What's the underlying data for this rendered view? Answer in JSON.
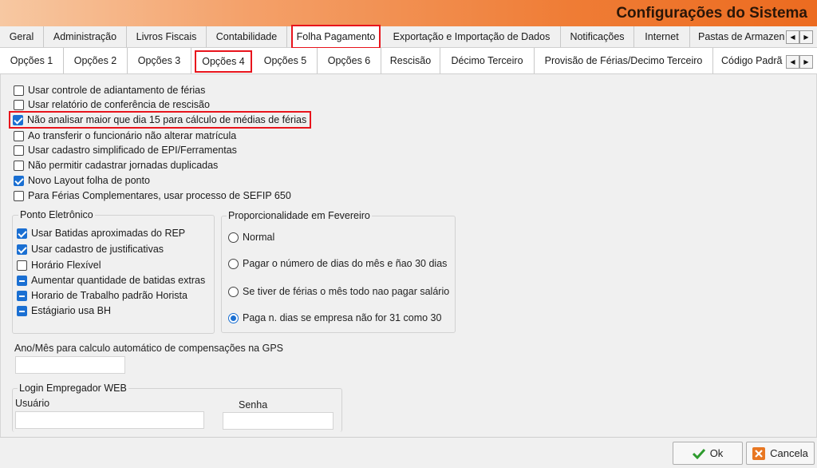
{
  "window": {
    "title": "Configurações do Sistema"
  },
  "tabs_main": {
    "items": [
      "Geral",
      "Administração",
      "Livros Fiscais",
      "Contabilidade",
      "Folha Pagamento",
      "Exportação e Importação de Dados",
      "Notificações",
      "Internet",
      "Pastas de Armazen"
    ],
    "active": "Folha Pagamento"
  },
  "tabs_sub": {
    "items": [
      "Opções 1",
      "Opções 2",
      "Opções 3",
      "Opções 4",
      "Opções 5",
      "Opções 6",
      "Rescisão",
      "Décimo Terceiro",
      "Provisão de Férias/Decimo Terceiro",
      "Código Padrã"
    ],
    "active": "Opções 4"
  },
  "options": [
    {
      "label": "Usar controle de adiantamento de férias",
      "checked": false
    },
    {
      "label": "Usar relatório de conferência de rescisão",
      "checked": false
    },
    {
      "label": "Não analisar maior que dia 15 para cálculo de médias de férias",
      "checked": true
    },
    {
      "label": "Ao transferir o funcionário não alterar matrícula",
      "checked": false
    },
    {
      "label": "Usar cadastro simplificado de EPI/Ferramentas",
      "checked": false
    },
    {
      "label": "Não permitir cadastrar jornadas duplicadas",
      "checked": false
    },
    {
      "label": "Novo Layout folha de ponto",
      "checked": true
    },
    {
      "label": "Para Férias Complementares, usar processo de SEFIP 650",
      "checked": false
    }
  ],
  "ponto": {
    "title": "Ponto Eletrônico",
    "items": [
      {
        "label": "Usar Batidas aproximadas do REP",
        "state": "checked"
      },
      {
        "label": "Usar cadastro de justificativas",
        "state": "checked"
      },
      {
        "label": "Horário Flexível",
        "state": "unchecked"
      },
      {
        "label": "Aumentar quantidade de batidas extras",
        "state": "indeterminate"
      },
      {
        "label": "Horario de Trabalho padrão Horista",
        "state": "indeterminate"
      },
      {
        "label": "Estágiario usa BH",
        "state": "indeterminate"
      }
    ]
  },
  "proporcionalidade": {
    "title": "Proporcionalidade em Fevereiro",
    "items": [
      {
        "label": "Normal",
        "selected": false
      },
      {
        "label": "Pagar o número de dias do mês e ñao 30 dias",
        "selected": false
      },
      {
        "label": "Se tiver de férias o mês todo nao pagar salário",
        "selected": false
      },
      {
        "label": "Paga n. dias se empresa não for 31 como 30",
        "selected": true
      }
    ]
  },
  "gps": {
    "label": "Ano/Mês para calculo automático de compensações na GPS",
    "value": ""
  },
  "login": {
    "title": "Login Empregador WEB",
    "usuario_label": "Usuário",
    "usuario_value": "",
    "senha_label": "Senha",
    "senha_value": ""
  },
  "footer": {
    "ok_label": "Ok",
    "cancel_label": "Cancela"
  },
  "colors": {
    "title_gradient_end": "#ec6b20",
    "highlight": "#e8141c",
    "check_blue": "#1a6fd2"
  }
}
